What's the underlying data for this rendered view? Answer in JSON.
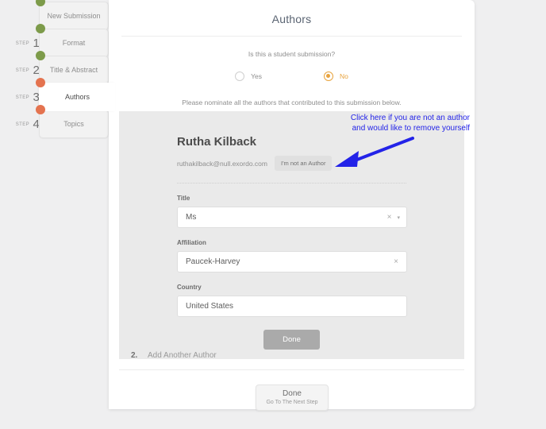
{
  "sidebar": {
    "step_word": "STEP",
    "items": [
      {
        "label": "New Submission",
        "step": "",
        "dot": "green",
        "active": false
      },
      {
        "label": "Format",
        "step": "1.",
        "dot": "green",
        "active": false
      },
      {
        "label": "Title & Abstract",
        "step": "2.",
        "dot": "green",
        "active": false
      },
      {
        "label": "Authors",
        "step": "3.",
        "dot": "orange",
        "active": true
      },
      {
        "label": "Topics",
        "step": "4.",
        "dot": "orange",
        "active": false
      }
    ]
  },
  "main": {
    "title": "Authors",
    "question": "Is this a student submission?",
    "radios": [
      {
        "label": "Yes",
        "selected": false
      },
      {
        "label": "No",
        "selected": true
      }
    ],
    "nominate_text": "Please nominate all the authors that contributed to this submission below."
  },
  "author": {
    "name": "Rutha Kilback",
    "email": "ruthakilback@null.exordo.com",
    "not_author_button": "I'm not an Author",
    "fields": [
      {
        "label": "Title",
        "value": "Ms",
        "has_clear": true,
        "has_caret": true
      },
      {
        "label": "Affiliation",
        "value": "Paucek-Harvey",
        "has_clear": true,
        "has_caret": false
      },
      {
        "label": "Country",
        "value": "United States",
        "has_clear": false,
        "has_caret": false
      }
    ],
    "done_button": "Done"
  },
  "add_author": {
    "number": "2.",
    "label": "Add Another Author"
  },
  "bottom_button": {
    "main": "Done",
    "sub": "Go To The Next Step"
  },
  "annotation": {
    "line1": "Click here if you are not an author",
    "line2": "and would like to remove yourself",
    "color": "#2323e8"
  },
  "icons": {
    "clear": "×",
    "caret_down": "▾"
  },
  "colors": {
    "page_bg": "#efeff0",
    "panel_bg": "#eaeaea",
    "dot_green": "#7d9b4a",
    "dot_orange": "#e4734f",
    "accent_orange": "#e8a33d",
    "annotation_blue": "#2323e8"
  }
}
